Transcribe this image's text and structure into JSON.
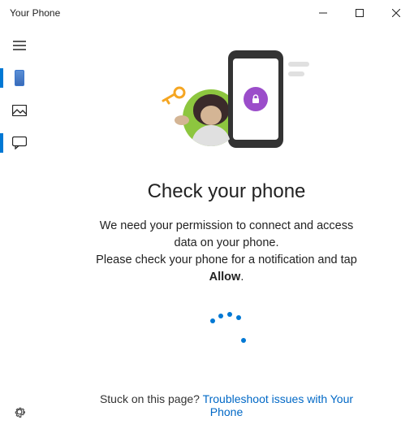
{
  "titlebar": {
    "title": "Your Phone"
  },
  "sidebar": {
    "items": [
      {
        "name": "hamburger"
      },
      {
        "name": "phone",
        "selected": true
      },
      {
        "name": "photos"
      },
      {
        "name": "messages",
        "selected": true
      }
    ],
    "settings": "Settings"
  },
  "main": {
    "heading": "Check your phone",
    "line1": "We need your permission to connect and access data on your phone.",
    "line2_pre": "Please check your phone for a notification and tap ",
    "line2_bold": "Allow",
    "line2_post": "."
  },
  "footer": {
    "prompt": "Stuck on this page? ",
    "link": "Troubleshoot issues with Your Phone"
  }
}
